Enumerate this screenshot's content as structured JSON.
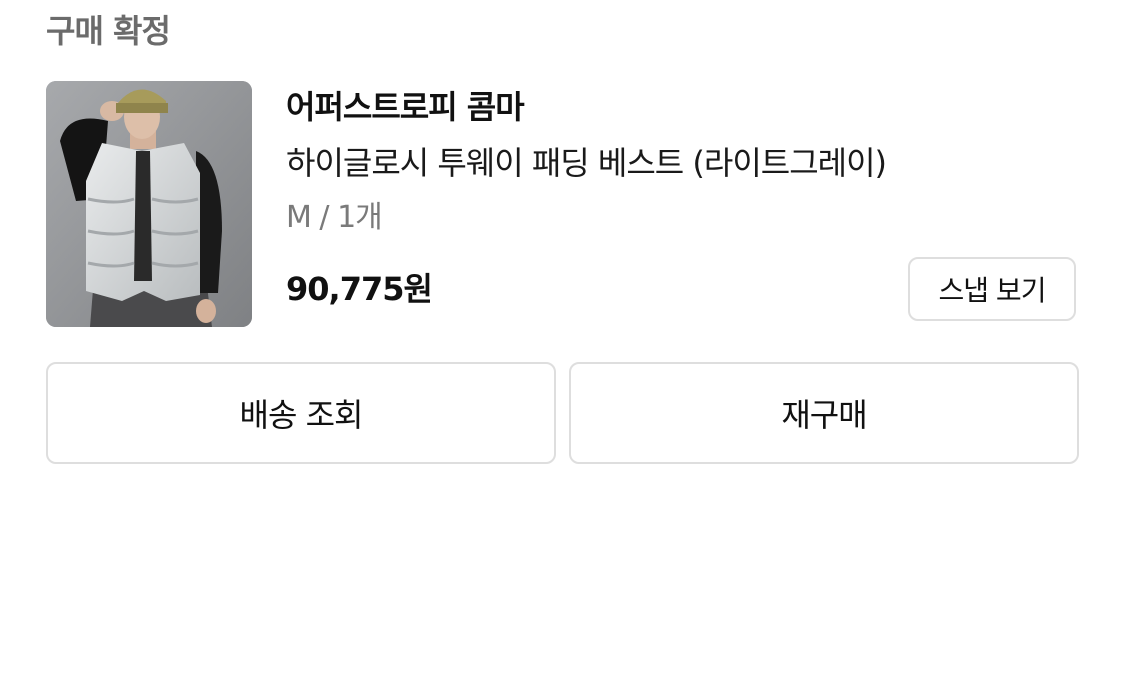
{
  "order": {
    "status": "구매 확정",
    "brand": "어퍼스트로피 콤마",
    "product_name": "하이글로시 투웨이 패딩 베스트 (라이트그레이)",
    "option": "M / 1개",
    "price": "90,775원"
  },
  "buttons": {
    "snap": "스냅 보기",
    "delivery": "배송 조회",
    "rebuy": "재구매"
  },
  "colors": {
    "status_text": "#6b6b6b",
    "option_text": "#7a7a7a",
    "button_border": "#dedede"
  }
}
